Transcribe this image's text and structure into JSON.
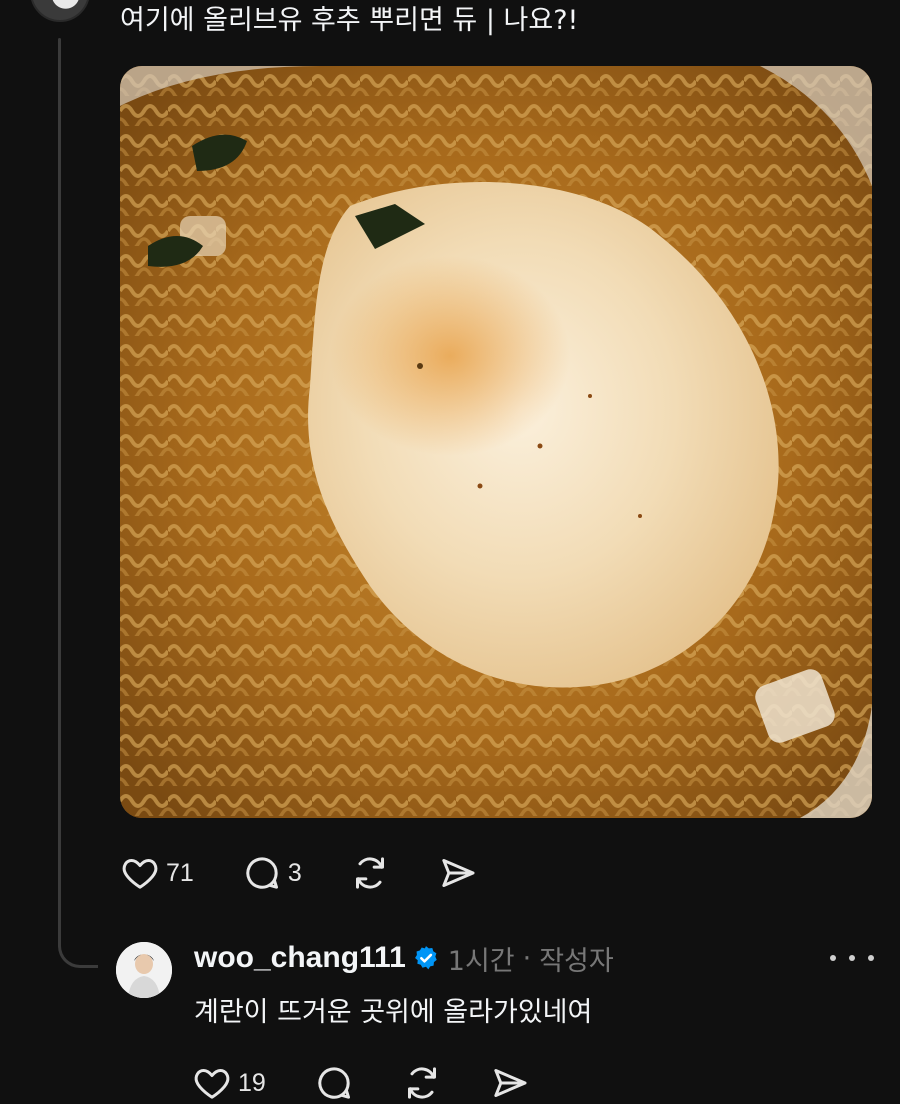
{
  "post": {
    "text": "여기에 올리브유 후추 뿌리면 듀 | 나요?!",
    "image_alt": "ramen-with-fried-egg-photo",
    "actions": {
      "like_count": "71",
      "reply_count": "3"
    }
  },
  "reply": {
    "username": "woo_chang111",
    "time": "1시간",
    "separator": "·",
    "author_label": "작성자",
    "text": "계란이 뜨거운 곳위에 올라가있네여",
    "actions": {
      "like_count": "19"
    }
  },
  "icons": {
    "like": "heart-icon",
    "reply": "comment-bubble-icon",
    "repost": "repost-icon",
    "share": "send-icon",
    "verified": "verified-badge-icon",
    "more": "more-icon"
  },
  "colors": {
    "background": "#101010",
    "text": "#f3f5f7",
    "muted": "#777777",
    "verified": "#0095f6",
    "thread_line": "#3b3b3b"
  }
}
